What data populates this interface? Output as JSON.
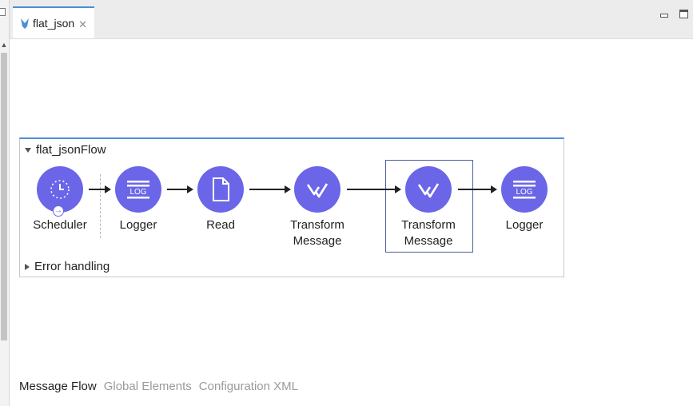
{
  "editor_tab": {
    "label": "flat_json",
    "icon": "mule-icon",
    "close": "✕"
  },
  "window_controls": {
    "minimize": "minimize-icon",
    "maximize": "maximize-icon"
  },
  "flow": {
    "name": "flat_jsonFlow",
    "error_handling": "Error handling",
    "components": [
      {
        "label": "Scheduler",
        "icon": "scheduler-icon"
      },
      {
        "label": "Logger",
        "icon": "log-icon"
      },
      {
        "label": "Read",
        "icon": "file-icon"
      },
      {
        "label": "Transform\nMessage",
        "icon": "transform-icon"
      },
      {
        "label": "Transform\nMessage",
        "icon": "transform-icon",
        "selected": true
      },
      {
        "label": "Logger",
        "icon": "log-icon"
      }
    ]
  },
  "bottom_tabs": [
    {
      "label": "Message Flow",
      "active": true
    },
    {
      "label": "Global Elements",
      "active": false
    },
    {
      "label": "Configuration XML",
      "active": false
    }
  ],
  "colors": {
    "component": "#6b66e8",
    "accent": "#4a90d9",
    "selection_border": "#4e5fa0"
  }
}
